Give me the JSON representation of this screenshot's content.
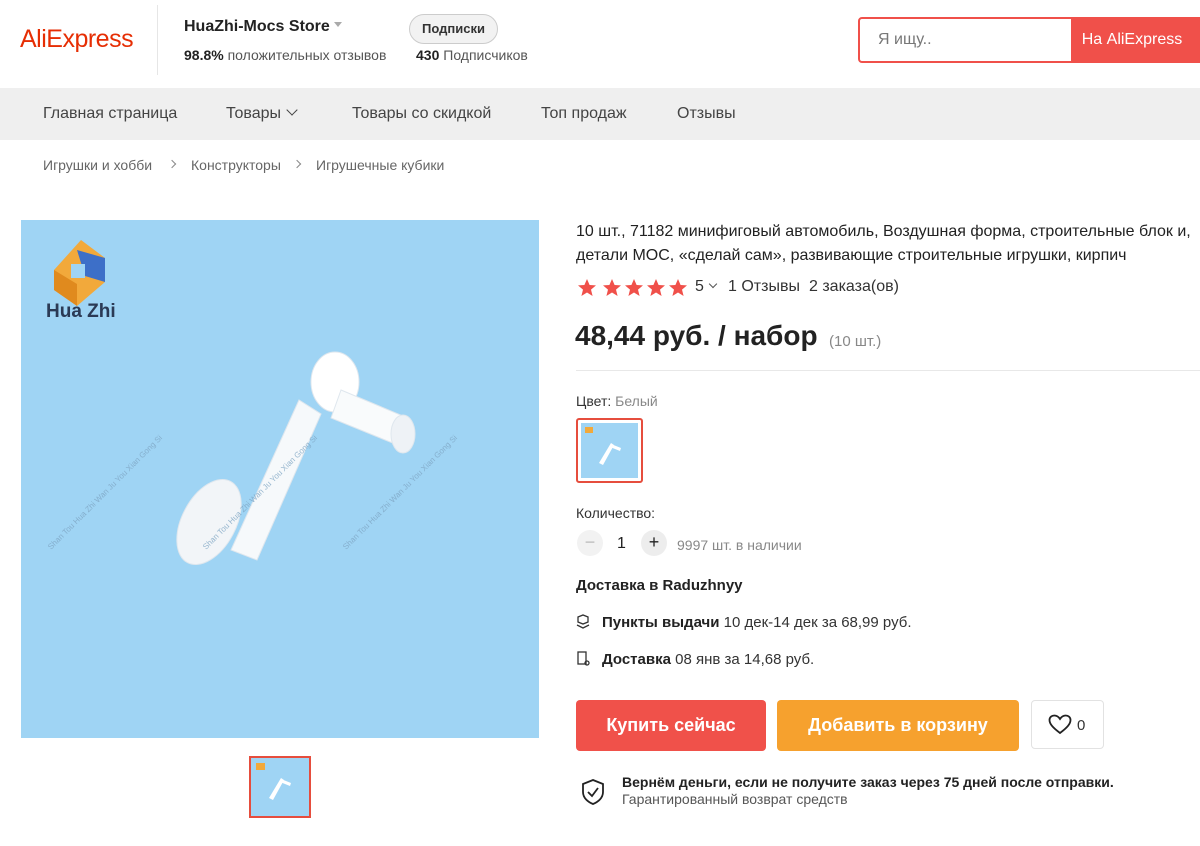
{
  "header": {
    "logo": "AliExpress",
    "store_name": "HuaZhi-Mocs Store",
    "positive_percent": "98.8%",
    "positive_label": "положительных отзывов",
    "subscribe_label": "Подписки",
    "subscribers_count": "430",
    "subscribers_label": "Подписчиков",
    "search_placeholder": "Я ищу..",
    "search_button": "На AliExpress"
  },
  "nav": {
    "items": [
      "Главная страница",
      "Товары",
      "Товары со скидкой",
      "Топ продаж",
      "Отзывы"
    ]
  },
  "breadcrumb": [
    "Игрушки и хобби",
    "Конструкторы",
    "Игрушечные кубики"
  ],
  "gallery": {
    "brand_text": "Hua Zhi",
    "watermark": "Shan Tou Hua Zhi Wan Ju You Xian Gong Si"
  },
  "product": {
    "title": "10 шт., 71182 минифиговый автомобиль, Воздушная форма, строительные блок и, детали МОС, «сделай сам», развивающие строительные игрушки, кирпич",
    "rating": "5",
    "stars": 5,
    "reviews": "1 Отзывы",
    "orders": "2 заказа(ов)",
    "price": "48,44 руб. / набор",
    "price_unit": "(10 шт.)",
    "color_label": "Цвет:",
    "color_value": "Белый",
    "quantity_label": "Количество:",
    "quantity_minus": "−",
    "quantity": "1",
    "quantity_plus": "+",
    "stock": "9997 шт. в наличии",
    "delivery_heading": "Доставка в Raduzhnyy",
    "pickup_label": "Пункты выдачи",
    "pickup_text": "10 дек-14 дек за 68,99 руб.",
    "delivery_label": "Доставка",
    "delivery_text": "08 янв за 14,68 руб.",
    "buy_now": "Купить сейчас",
    "add_to_cart": "Добавить в корзину",
    "wishlist_count": "0",
    "guarantee_title": "Вернём деньги, если не получите заказ через 75 дней после отправки.",
    "guarantee_sub": "Гарантированный возврат средств"
  },
  "colors": {
    "accent": "#f0504a",
    "cart": "#f6a12e",
    "star": "#f0504a",
    "image_bg": "#9fd4f4"
  }
}
